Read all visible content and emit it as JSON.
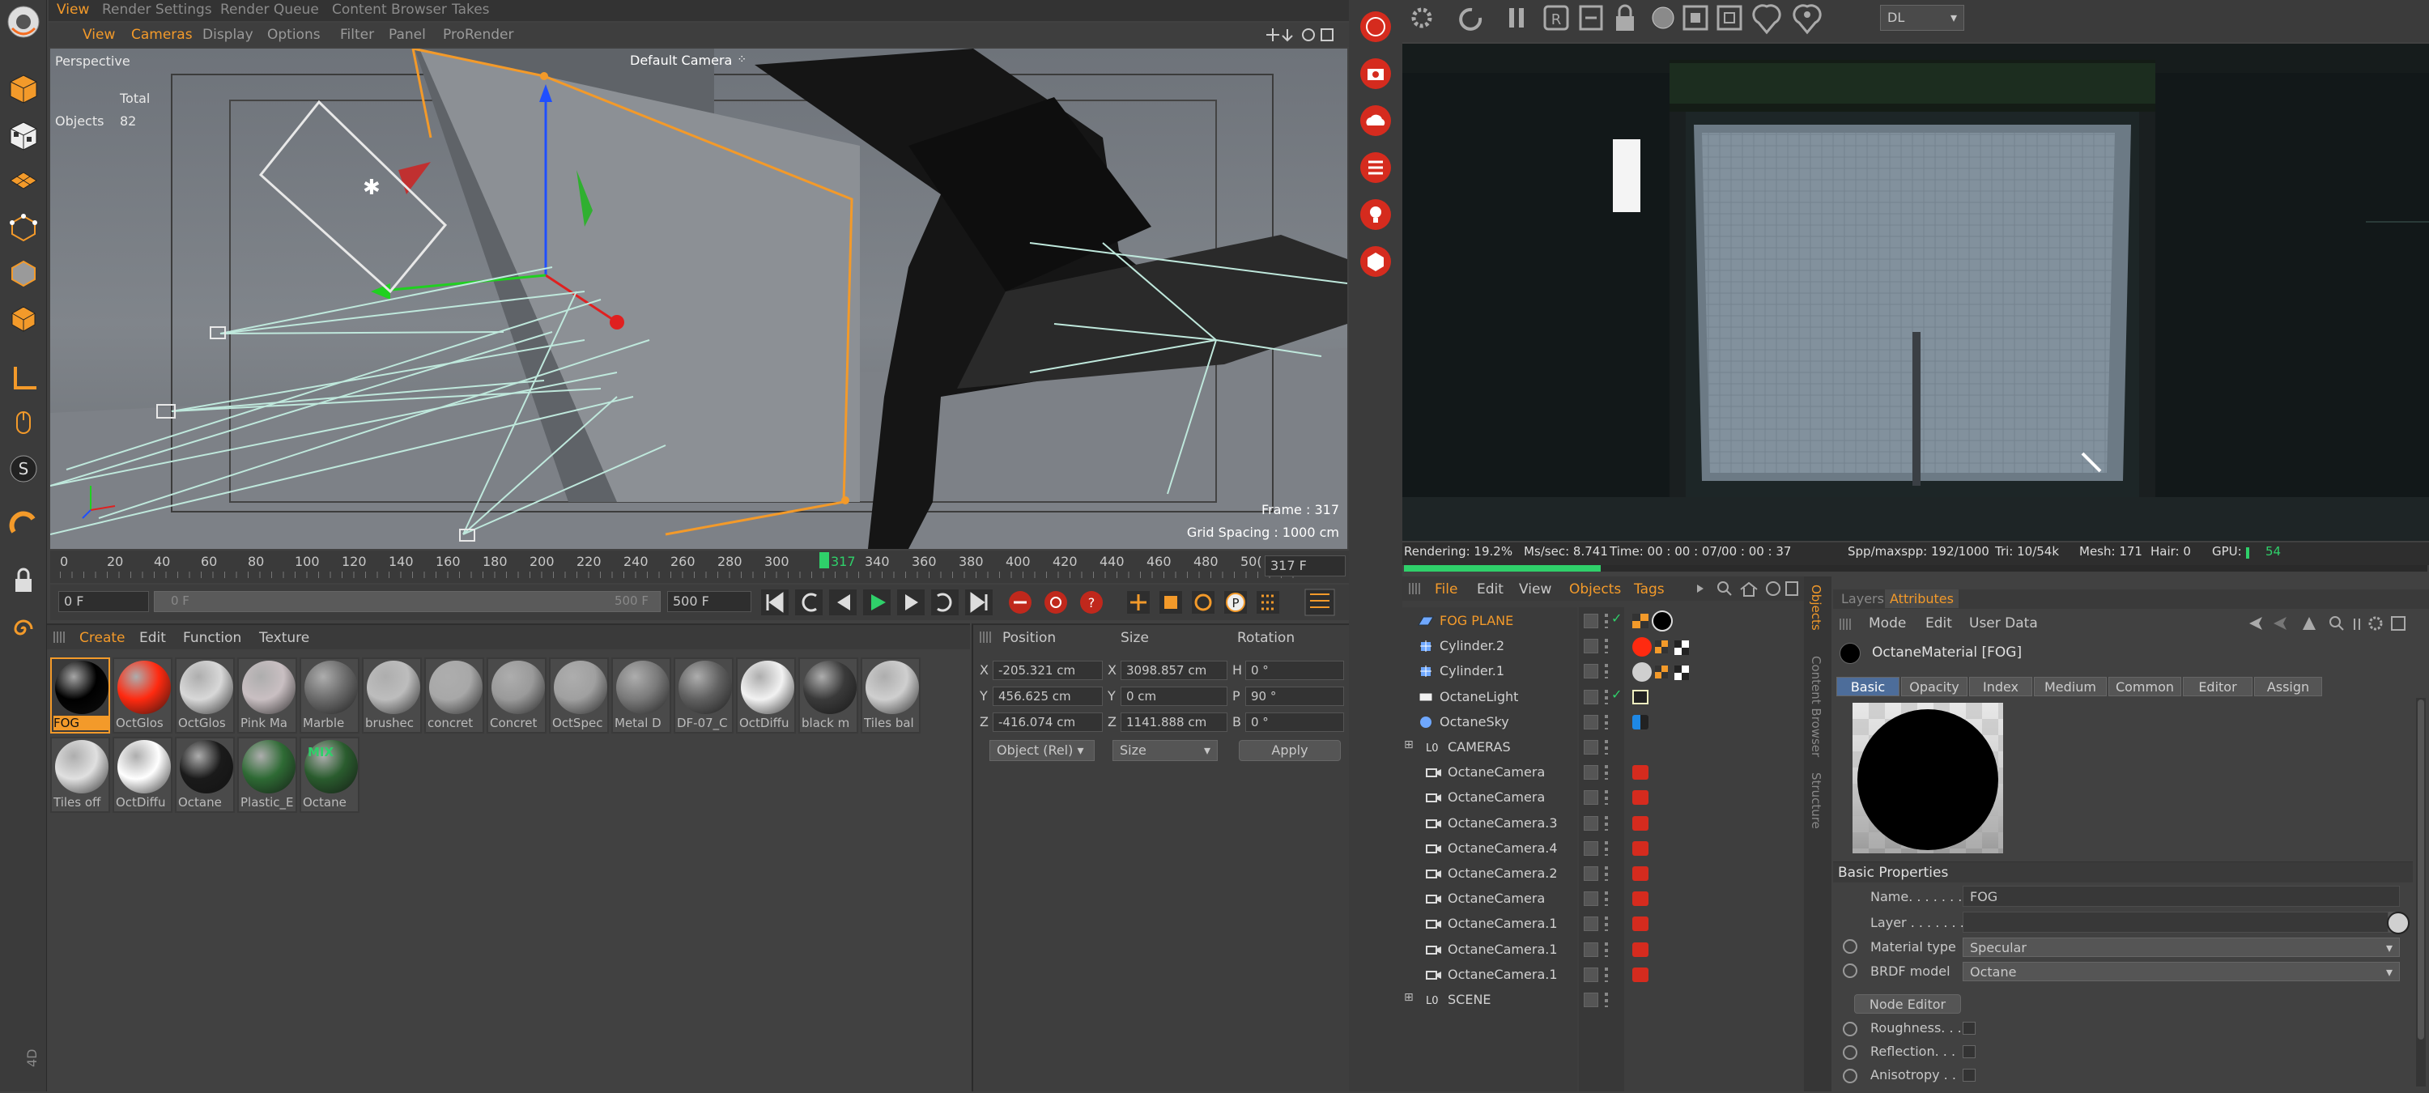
{
  "top_tabs": [
    "View",
    "Render Settings",
    "Render Queue",
    "Content Browser",
    "Takes"
  ],
  "viewport_menu": [
    "View",
    "Cameras",
    "Display",
    "Options",
    "Filter",
    "Panel",
    "ProRender"
  ],
  "viewport": {
    "name": "Perspective",
    "camera": "Default Camera",
    "total_label": "Total",
    "objects_label": "Objects",
    "objects_count": "82",
    "frame": "Frame : 317",
    "grid_spacing": "Grid Spacing : 1000 cm"
  },
  "timeline": {
    "ticks": [
      "0",
      "20",
      "40",
      "60",
      "80",
      "100",
      "120",
      "140",
      "160",
      "180",
      "200",
      "220",
      "240",
      "260",
      "280",
      "300",
      "340",
      "360",
      "380",
      "400",
      "420",
      "440",
      "460",
      "480",
      "50("
    ],
    "current": "317",
    "current_field": "317 F"
  },
  "transport": {
    "start": "0 F",
    "slider_start": "0 F",
    "slider_end": "500 F",
    "end": "500 F"
  },
  "materials_menu": [
    "Create",
    "Edit",
    "Function",
    "Texture"
  ],
  "materials_row1": [
    {
      "name": "FOG",
      "color": "#000000"
    },
    {
      "name": "OctGlos",
      "color": "#ff2a10"
    },
    {
      "name": "OctGlos",
      "color": "#d8d8d8"
    },
    {
      "name": "Pink Ma",
      "color": "#c9bfc2"
    },
    {
      "name": "Marble",
      "color": "#6b6b6b"
    },
    {
      "name": "brushec",
      "color": "#bdbdbd"
    },
    {
      "name": "concret",
      "color": "#a8a8a8"
    },
    {
      "name": "Concret",
      "color": "#9a9a9a"
    },
    {
      "name": "OctSpec",
      "color": "#a0a0a0"
    },
    {
      "name": "Metal D",
      "color": "#7a7a7a"
    },
    {
      "name": "DF-07_C",
      "color": "#606060"
    },
    {
      "name": "OctDiffu",
      "color": "#f2f2f2"
    },
    {
      "name": "black m",
      "color": "#3a3a3a"
    },
    {
      "name": "Tiles bal",
      "color": "#cfcfcf"
    }
  ],
  "materials_row2": [
    {
      "name": "Tiles off",
      "color": "#e0e0e0"
    },
    {
      "name": "OctDiffu",
      "color": "#ffffff"
    },
    {
      "name": "Octane",
      "color": "#1a1a1a"
    },
    {
      "name": "Plastic_E",
      "color": "#2e6a34"
    },
    {
      "name": "Octane",
      "color": "#2a5c2e",
      "badge": "MIX"
    }
  ],
  "coords": {
    "headers": [
      "Position",
      "Size",
      "Rotation"
    ],
    "rows": [
      {
        "axis": "X",
        "pos": "-205.321 cm",
        "saxis": "X",
        "size": "3098.857 cm",
        "raxis": "H",
        "rot": "0 °"
      },
      {
        "axis": "Y",
        "pos": "456.625 cm",
        "saxis": "Y",
        "size": "0 cm",
        "raxis": "P",
        "rot": "90 °"
      },
      {
        "axis": "Z",
        "pos": "-416.074 cm",
        "saxis": "Z",
        "size": "1141.888 cm",
        "raxis": "B",
        "rot": "0 °"
      }
    ],
    "mode": "Object (Rel)",
    "size_mode": "Size",
    "apply": "Apply"
  },
  "render": {
    "dropdown": "DL",
    "status": {
      "rendering": "Rendering: 19.2%",
      "ms": "Ms/sec: 8.741",
      "time": "Time: 00 : 00 : 07/00 : 00 : 37",
      "spp": "Spp/maxspp: 192/1000",
      "tri": "Tri: 10/54k",
      "mesh": "Mesh: 171",
      "hair": "Hair: 0",
      "gpu": "GPU:",
      "gpu_val": "54"
    },
    "progress": 0.192
  },
  "objects_menu": [
    "File",
    "Edit",
    "View",
    "Objects",
    "Tags"
  ],
  "objects": [
    {
      "name": "FOG PLANE",
      "indent": 0,
      "highlight": true,
      "icon": "plane"
    },
    {
      "name": "Cylinder.2",
      "indent": 0,
      "icon": "cyl"
    },
    {
      "name": "Cylinder.1",
      "indent": 0,
      "icon": "cyl"
    },
    {
      "name": "OctaneLight",
      "indent": 0,
      "icon": "light"
    },
    {
      "name": "OctaneSky",
      "indent": 0,
      "icon": "sky"
    },
    {
      "name": "CAMERAS",
      "indent": 0,
      "icon": "null",
      "group": true
    },
    {
      "name": "OctaneCamera",
      "indent": 1,
      "icon": "cam"
    },
    {
      "name": "OctaneCamera",
      "indent": 1,
      "icon": "cam"
    },
    {
      "name": "OctaneCamera.3",
      "indent": 1,
      "icon": "cam"
    },
    {
      "name": "OctaneCamera.4",
      "indent": 1,
      "icon": "cam"
    },
    {
      "name": "OctaneCamera.2",
      "indent": 1,
      "icon": "cam"
    },
    {
      "name": "OctaneCamera",
      "indent": 1,
      "icon": "cam"
    },
    {
      "name": "OctaneCamera.1",
      "indent": 1,
      "icon": "cam"
    },
    {
      "name": "OctaneCamera.1",
      "indent": 1,
      "icon": "cam"
    },
    {
      "name": "OctaneCamera.1",
      "indent": 1,
      "icon": "cam"
    },
    {
      "name": "SCENE",
      "indent": 0,
      "icon": "null",
      "group": true
    }
  ],
  "side_tabs": [
    "Objects",
    "Content Browser",
    "Structure"
  ],
  "attributes": {
    "tabs": [
      "Layers",
      "Attributes"
    ],
    "menu": [
      "Mode",
      "Edit",
      "User Data"
    ],
    "title": "OctaneMaterial [FOG]",
    "subtabs": [
      "Basic",
      "Opacity",
      "Index",
      "Medium",
      "Common",
      "Editor",
      "Assign"
    ],
    "section": "Basic Properties",
    "name_label": "Name. . . . . . .",
    "name_value": "FOG",
    "layer_label": "Layer . . . . . . .",
    "mat_type_label": "Material type",
    "mat_type": "Specular",
    "brdf_label": "BRDF model",
    "brdf": "Octane",
    "node_editor": "Node Editor",
    "checks": [
      "Roughness. . .",
      "Reflection. . .",
      "Anisotropy . ."
    ]
  }
}
